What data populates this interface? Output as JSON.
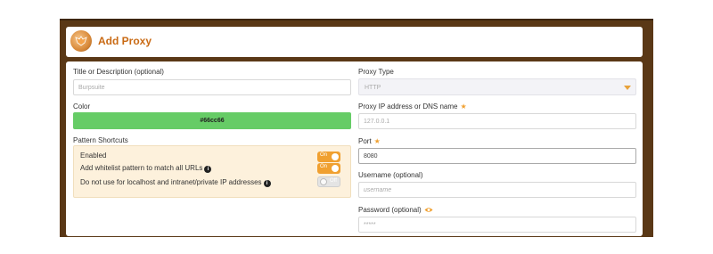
{
  "header": {
    "title": "Add Proxy"
  },
  "left": {
    "title_label": "Title or Description (optional)",
    "title_value": "Burpsuite",
    "color_label": "Color",
    "color_value": "#66cc66",
    "shortcuts_label": "Pattern Shortcuts",
    "shortcuts": [
      {
        "label": "Enabled",
        "state": "On",
        "info": false
      },
      {
        "label": "Add whitelist pattern to match all URLs",
        "state": "On",
        "info": true
      },
      {
        "label": "Do not use for localhost and intranet/private IP addresses",
        "state": "Off",
        "info": true
      }
    ]
  },
  "right": {
    "type_label": "Proxy Type",
    "type_value": "HTTP",
    "ip_label": "Proxy IP address or DNS name",
    "ip_value": "127.0.0.1",
    "port_label": "Port",
    "port_value": "8080",
    "username_label": "Username (optional)",
    "username_placeholder": "username",
    "password_label": "Password (optional)",
    "password_placeholder": "*****"
  },
  "colors": {
    "accent": "#f0a030",
    "frame": "#5a3816",
    "title": "#c96a14",
    "proxy_color": "#66cc66"
  }
}
